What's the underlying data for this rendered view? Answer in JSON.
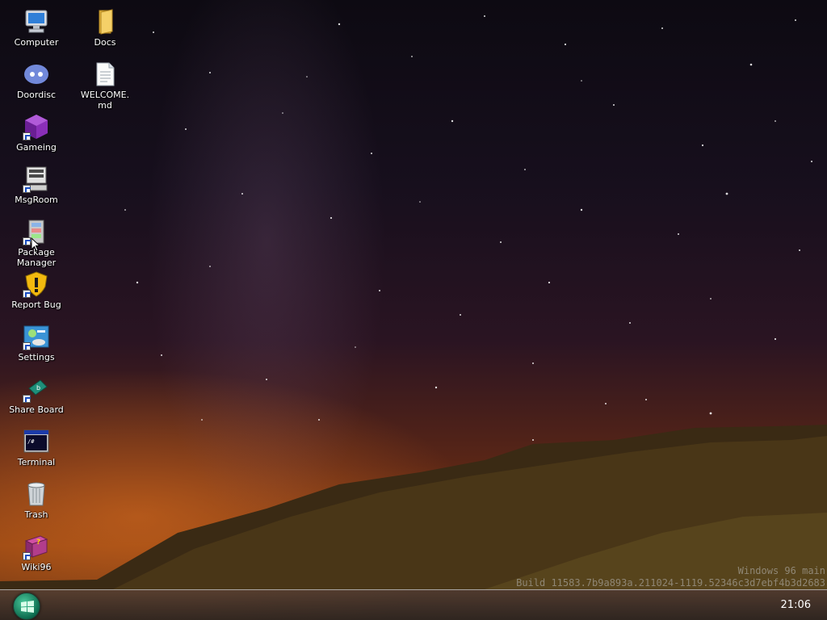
{
  "desktop": {
    "icons": [
      {
        "label": "Computer",
        "icon": "computer-icon"
      },
      {
        "label": "Docs",
        "icon": "folder-icon"
      },
      {
        "label": "Doordisc",
        "icon": "discord-icon"
      },
      {
        "label": "WELCOME.\nmd",
        "icon": "document-icon"
      },
      {
        "label": "Gameing",
        "icon": "cube-icon"
      },
      {
        "label": "MsgRoom",
        "icon": "msgroom-icon"
      },
      {
        "label": "Package\nManager",
        "icon": "package-icon"
      },
      {
        "label": "Report Bug",
        "icon": "shield-warning-icon"
      },
      {
        "label": "Settings",
        "icon": "settings-icon"
      },
      {
        "label": "Share Board",
        "icon": "shareboard-icon"
      },
      {
        "label": "Terminal",
        "icon": "terminal-icon"
      },
      {
        "label": "Trash",
        "icon": "trash-icon"
      },
      {
        "label": "Wiki96",
        "icon": "book-icon"
      }
    ]
  },
  "watermark": {
    "line1": "Windows 96 main",
    "line2": "Build 11583.7b9a893a.211024-1119.52346c3d7ebf4b3d2683"
  },
  "taskbar": {
    "start_icon": "windows-logo-icon",
    "clock": "21:06"
  }
}
